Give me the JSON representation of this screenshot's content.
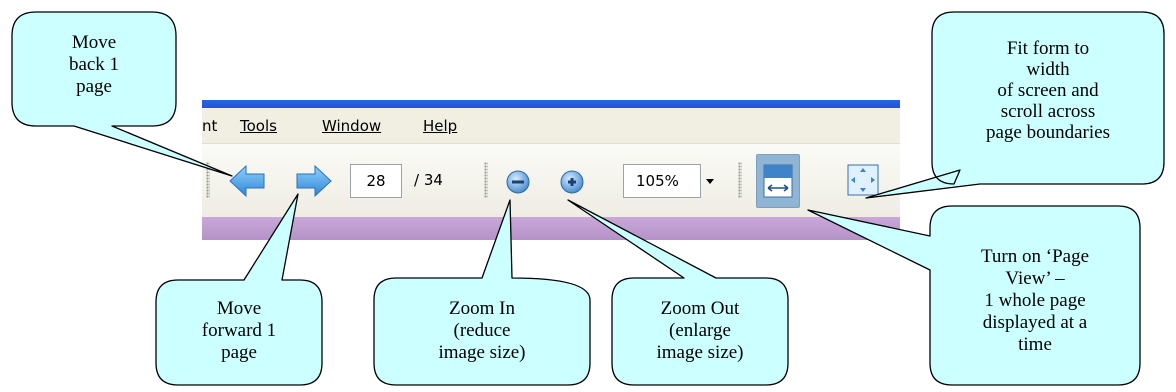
{
  "menu": {
    "items": [
      {
        "label": "nt"
      },
      {
        "label": "Tools"
      },
      {
        "label": "Window"
      },
      {
        "label": "Help"
      }
    ]
  },
  "toolbar": {
    "current_page": "28",
    "page_total": "/ 34",
    "zoom_value": "105%",
    "icons": {
      "previous": "arrow-left-icon",
      "next": "arrow-right-icon",
      "zoom_out": "minus-circle-icon",
      "zoom_in": "plus-circle-icon",
      "dropdown": "chevron-down-icon",
      "fit_width": "fit-width-icon",
      "fit_page": "fit-page-icon"
    }
  },
  "callouts": {
    "back": "Move\nback 1\npage",
    "forward": "Move\nforward 1\npage",
    "zoom_in": "Zoom In\n(reduce\nimage size)",
    "zoom_out": "Zoom Out\n(enlarge\nimage size)",
    "fit_width": "Fit form to\nwidth\nof screen and\nscroll across\npage boundaries",
    "page_view": "Turn on ‘Page\nView’ –\n1 whole page\ndisplayed  at a\ntime"
  },
  "colors": {
    "callout_fill": "#ccffff",
    "title_bar": "#2a63e6",
    "arrow_blue": "#3d9ee6",
    "active_button": "#8fb4d4",
    "doc_strip": "#c9a8d8"
  }
}
